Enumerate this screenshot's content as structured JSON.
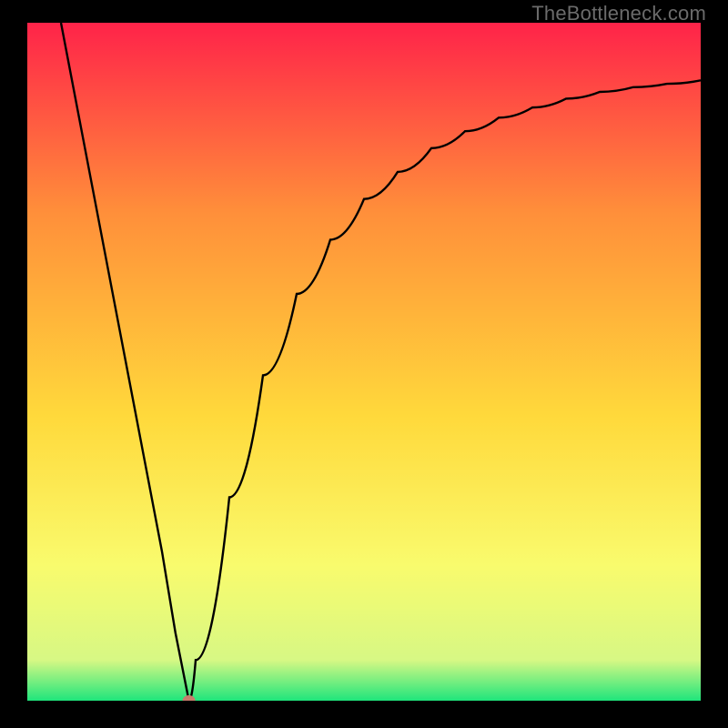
{
  "watermark": "TheBottleneck.com",
  "chart_data": {
    "type": "line",
    "title": "",
    "xlabel": "",
    "ylabel": "",
    "xlim": [
      0,
      100
    ],
    "ylim": [
      0,
      100
    ],
    "background_gradient": {
      "top": "#ff2349",
      "mid_upper": "#ff8f3a",
      "mid": "#ffd93b",
      "mid_lower": "#f9fb6d",
      "near_bottom": "#d7f884",
      "bottom": "#1fe57c"
    },
    "series": [
      {
        "name": "bottleneck-curve",
        "color": "#000000",
        "x": [
          5,
          10,
          15,
          20,
          22,
          24,
          25,
          30,
          35,
          40,
          45,
          50,
          55,
          60,
          65,
          70,
          75,
          80,
          85,
          90,
          95,
          100
        ],
        "y": [
          100,
          74,
          48,
          22,
          10,
          0,
          6,
          30,
          48,
          60,
          68,
          74,
          78,
          81.5,
          84,
          86,
          87.5,
          88.8,
          89.8,
          90.5,
          91,
          91.5
        ]
      }
    ],
    "marker": {
      "name": "optimal-point",
      "x": 24,
      "y": 0,
      "color": "#c87d6c"
    }
  }
}
